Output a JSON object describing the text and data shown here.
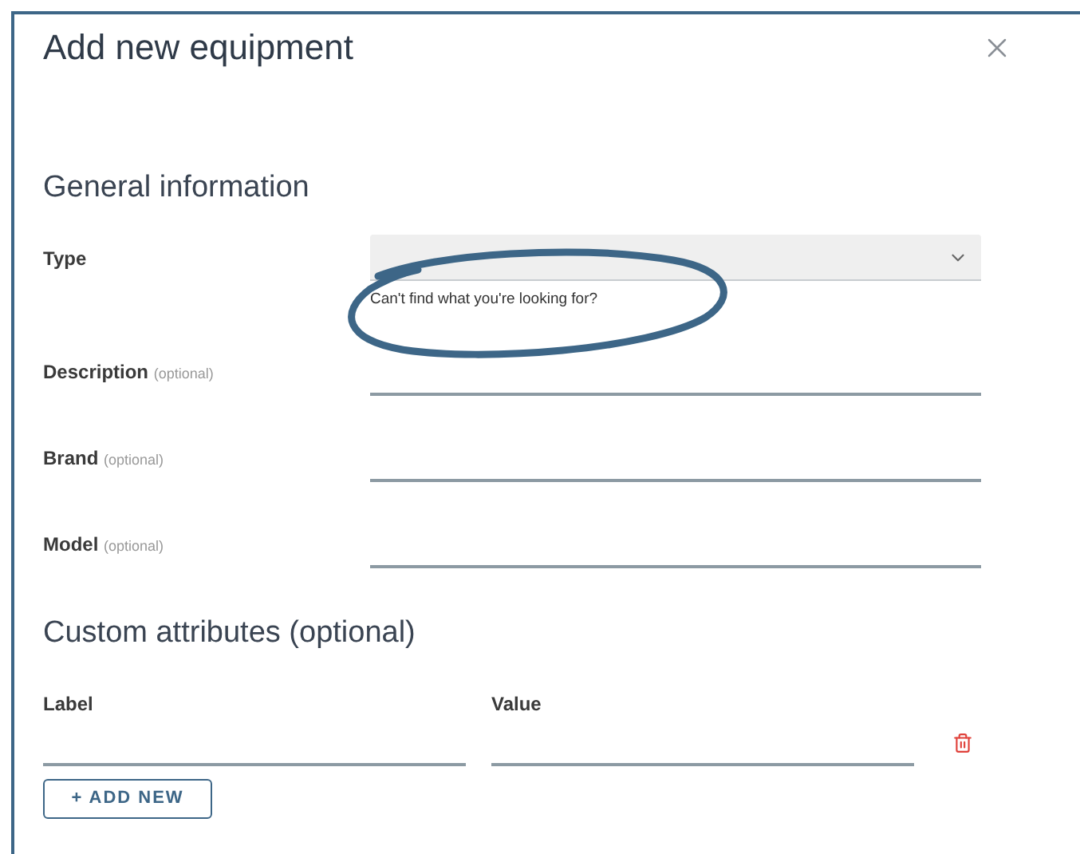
{
  "dialog": {
    "title": "Add new equipment"
  },
  "general_section": {
    "heading": "General information",
    "type_field": {
      "label": "Type",
      "help_link": "Can't find what you're looking for?",
      "circled": true
    },
    "fields": [
      {
        "label": "Description",
        "hint": "(optional)"
      },
      {
        "label": "Brand",
        "hint": "(optional)"
      },
      {
        "label": "Model",
        "hint": "(optional)"
      }
    ]
  },
  "custom_section": {
    "heading": "Custom attributes (optional)",
    "columns": [
      "Label",
      "Value"
    ],
    "add_button": "+ ADD NEW"
  }
}
